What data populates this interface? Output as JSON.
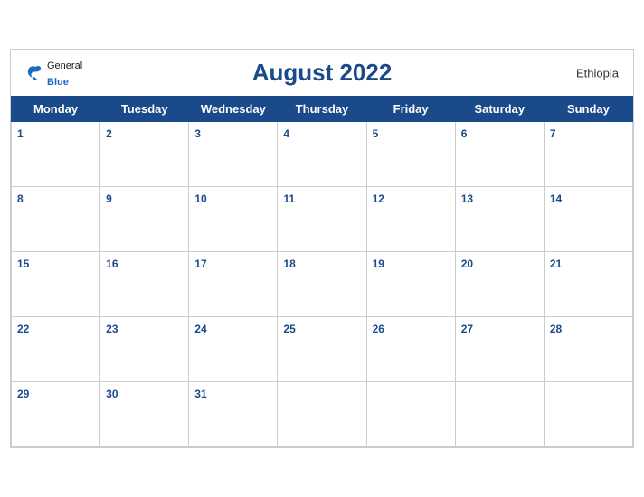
{
  "header": {
    "title": "August 2022",
    "country": "Ethiopia",
    "logo": {
      "general": "General",
      "blue": "Blue"
    }
  },
  "weekdays": [
    "Monday",
    "Tuesday",
    "Wednesday",
    "Thursday",
    "Friday",
    "Saturday",
    "Sunday"
  ],
  "weeks": [
    [
      {
        "day": 1
      },
      {
        "day": 2
      },
      {
        "day": 3
      },
      {
        "day": 4
      },
      {
        "day": 5
      },
      {
        "day": 6
      },
      {
        "day": 7
      }
    ],
    [
      {
        "day": 8
      },
      {
        "day": 9
      },
      {
        "day": 10
      },
      {
        "day": 11
      },
      {
        "day": 12
      },
      {
        "day": 13
      },
      {
        "day": 14
      }
    ],
    [
      {
        "day": 15
      },
      {
        "day": 16
      },
      {
        "day": 17
      },
      {
        "day": 18
      },
      {
        "day": 19
      },
      {
        "day": 20
      },
      {
        "day": 21
      }
    ],
    [
      {
        "day": 22
      },
      {
        "day": 23
      },
      {
        "day": 24
      },
      {
        "day": 25
      },
      {
        "day": 26
      },
      {
        "day": 27
      },
      {
        "day": 28
      }
    ],
    [
      {
        "day": 29
      },
      {
        "day": 30
      },
      {
        "day": 31
      },
      {
        "day": null
      },
      {
        "day": null
      },
      {
        "day": null
      },
      {
        "day": null
      }
    ]
  ]
}
